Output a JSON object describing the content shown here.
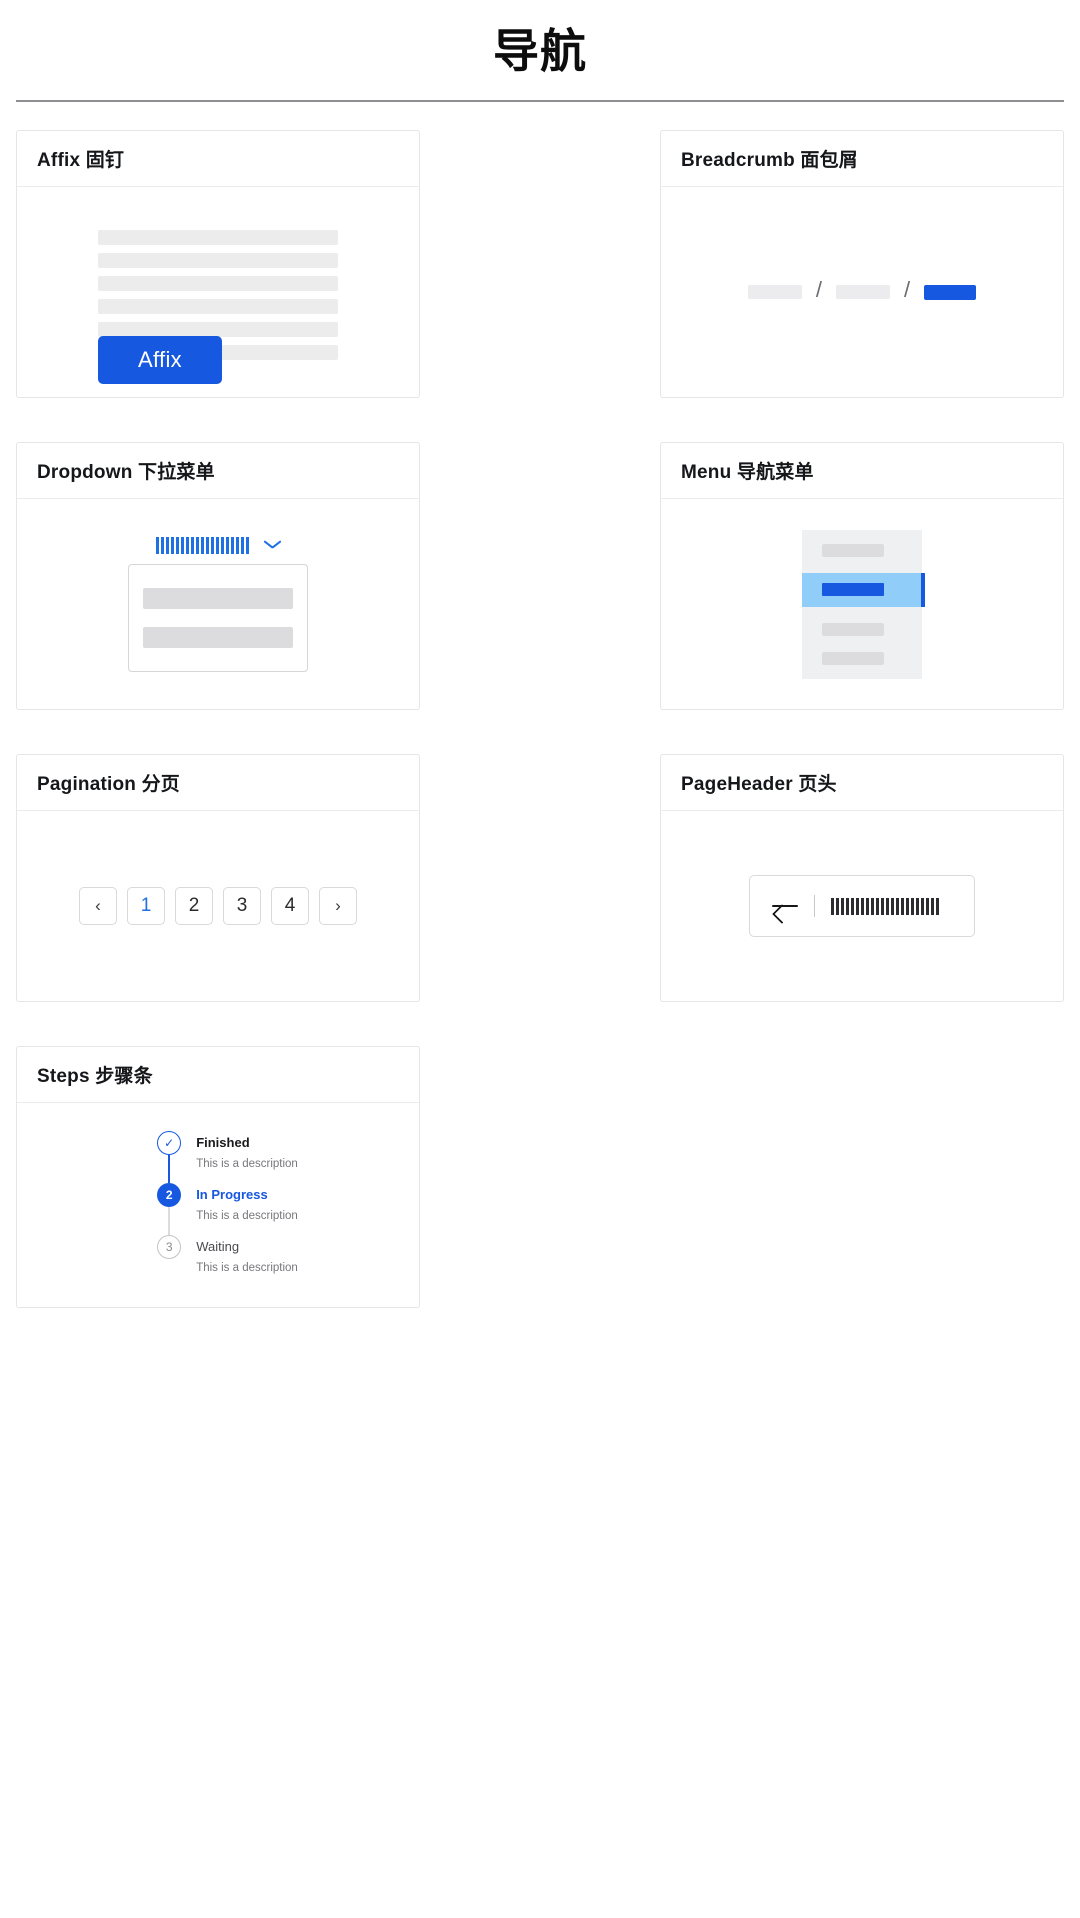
{
  "page": {
    "title": "导航"
  },
  "cards": {
    "affix": {
      "title": "Affix 固钉",
      "button_label": "Affix",
      "skeleton_line_count": 6
    },
    "breadcrumb": {
      "title": "Breadcrumb 面包屑",
      "separator": "/",
      "items": [
        {
          "kind": "chip",
          "state": "inactive"
        },
        {
          "kind": "chip",
          "state": "inactive"
        },
        {
          "kind": "chip",
          "state": "active"
        }
      ],
      "active_color": "#1658df"
    },
    "dropdown": {
      "title": "Dropdown 下拉菜单",
      "trigger_icon": "chevron-down-icon",
      "trigger_color": "#1f6fe5",
      "menu_item_count": 2
    },
    "menu": {
      "title": "Menu 导航菜单",
      "items": [
        {
          "state": "default"
        },
        {
          "state": "selected"
        },
        {
          "state": "default"
        },
        {
          "state": "default"
        }
      ],
      "selected_bg": "#90cdf8",
      "selected_accent": "#1658df"
    },
    "pagination": {
      "title": "Pagination 分页",
      "prev_label": "‹",
      "next_label": "›",
      "pages": [
        "1",
        "2",
        "3",
        "4"
      ],
      "current_page": "1",
      "active_color": "#1f6fe5"
    },
    "pageheader": {
      "title": "PageHeader 页头",
      "back_icon": "arrow-left-icon"
    },
    "steps": {
      "title": "Steps 步骤条",
      "items": [
        {
          "indicator": "✓",
          "label": "Finished",
          "description": "This is a description",
          "status": "finished"
        },
        {
          "indicator": "2",
          "label": "In Progress",
          "description": "This is a description",
          "status": "current"
        },
        {
          "indicator": "3",
          "label": "Waiting",
          "description": "This is a description",
          "status": "waiting"
        }
      ]
    }
  }
}
